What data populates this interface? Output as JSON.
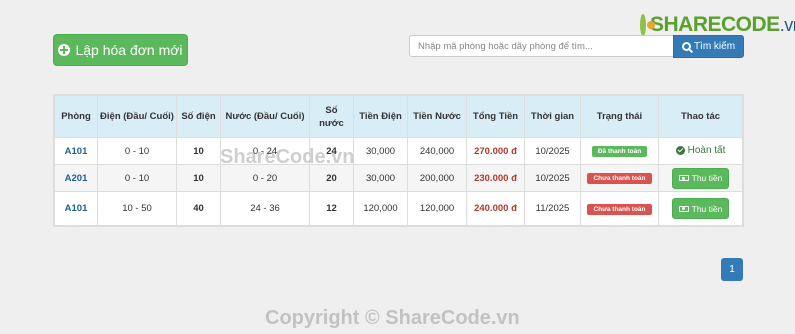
{
  "brand": {
    "logo_main": "SHARECODE",
    "logo_suffix": ".vn"
  },
  "toolbar": {
    "create_label": "Lập hóa đơn mới",
    "search_placeholder": "Nhập mã phòng hoặc dãy phòng để tìm...",
    "search_label": "Tìm kiếm"
  },
  "table": {
    "headers": [
      "Phòng",
      "Điện (Đầu/ Cuối)",
      "Số điện",
      "Nước (Đầu/ Cuối)",
      "Số nước",
      "Tiền Điện",
      "Tiền Nước",
      "Tổng Tiền",
      "Thời gian",
      "Trạng thái",
      "Thao tác"
    ],
    "rows": [
      {
        "room": "A101",
        "electric_range": "0 - 10",
        "electric_units": "10",
        "water_range": "0 - 24",
        "water_units": "24",
        "electric_cost": "30,000",
        "water_cost": "240,000",
        "total": "270.000 đ",
        "period": "10/2025",
        "status": "Đã thanh toán",
        "action": "Hoàn tất"
      },
      {
        "room": "A201",
        "electric_range": "0 - 10",
        "electric_units": "10",
        "water_range": "0 - 20",
        "water_units": "20",
        "electric_cost": "30,000",
        "water_cost": "200,000",
        "total": "230.000 đ",
        "period": "10/2025",
        "status": "Chưa thanh toán",
        "action": "Thu tiền"
      },
      {
        "room": "A101",
        "electric_range": "10 - 50",
        "electric_units": "40",
        "water_range": "24 - 36",
        "water_units": "12",
        "electric_cost": "120,000",
        "water_cost": "120,000",
        "total": "240.000 đ",
        "period": "11/2025",
        "status": "Chưa thanh toán",
        "action": "Thu tiền"
      }
    ]
  },
  "pagination": {
    "current": "1"
  },
  "watermarks": {
    "center": "ShareCode.vn",
    "footer": "Copyright © ShareCode.vn"
  },
  "colors": {
    "primary": "#337ab7",
    "success": "#5cb85c",
    "danger": "#d9534f",
    "table_header": "#d9edf7",
    "total_text": "#b03a2e"
  }
}
